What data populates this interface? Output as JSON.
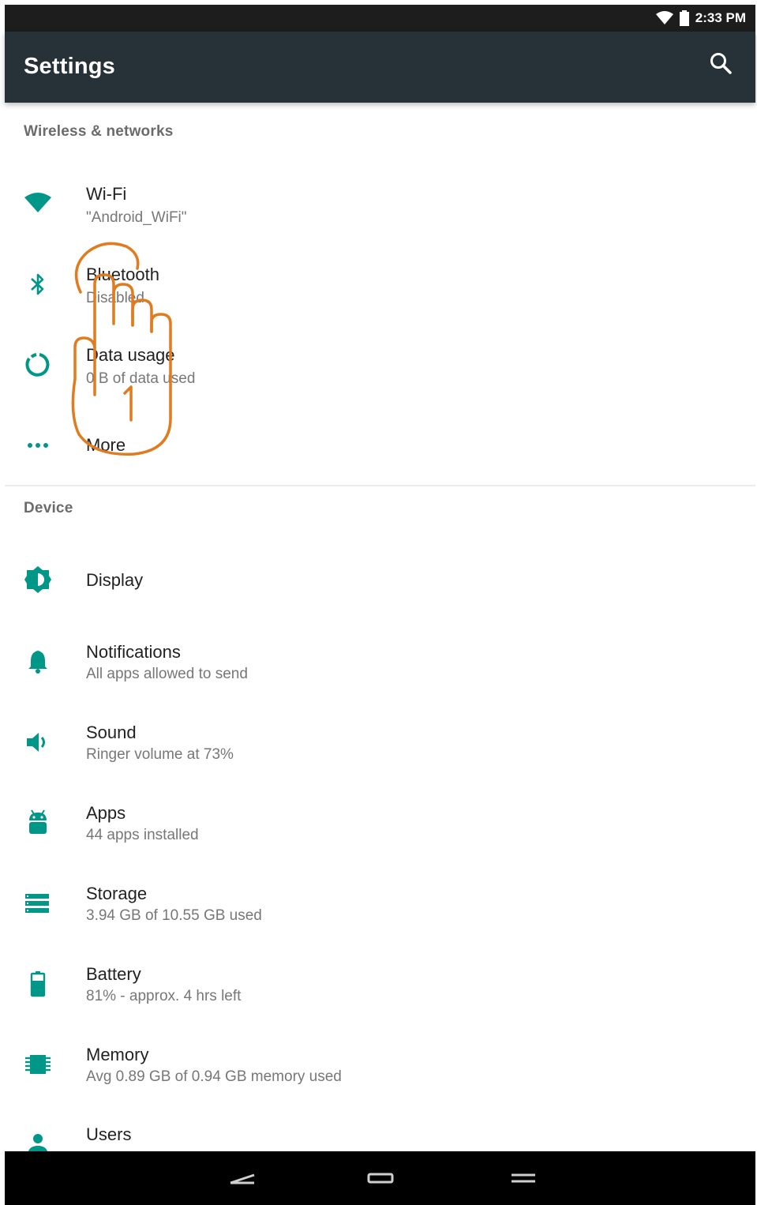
{
  "status_bar": {
    "time": "2:33 PM",
    "icons": [
      "wifi-icon",
      "battery-icon"
    ]
  },
  "app_bar": {
    "title": "Settings",
    "action_icon": "search-icon"
  },
  "colors": {
    "accent": "#009688",
    "app_bar": "#263238",
    "status_bar": "#1d1d1d",
    "gesture": "#e07b1f"
  },
  "sections": [
    {
      "header": "Wireless & networks",
      "items": [
        {
          "icon": "wifi-icon",
          "title": "Wi-Fi",
          "summary": "\"Android_WiFi\""
        },
        {
          "icon": "bluetooth-icon",
          "title": "Bluetooth",
          "summary": "Disabled"
        },
        {
          "icon": "data-usage-icon",
          "title": "Data usage",
          "summary": "0 B of data used"
        },
        {
          "icon": "more-icon",
          "title": "More",
          "summary": ""
        }
      ]
    },
    {
      "header": "Device",
      "items": [
        {
          "icon": "display-icon",
          "title": "Display",
          "summary": ""
        },
        {
          "icon": "notifications-icon",
          "title": "Notifications",
          "summary": "All apps allowed to send"
        },
        {
          "icon": "sound-icon",
          "title": "Sound",
          "summary": "Ringer volume at 73%"
        },
        {
          "icon": "apps-icon",
          "title": "Apps",
          "summary": "44 apps installed"
        },
        {
          "icon": "storage-icon",
          "title": "Storage",
          "summary": "3.94 GB of 10.55 GB used"
        },
        {
          "icon": "battery-icon",
          "title": "Battery",
          "summary": "81% - approx. 4 hrs left"
        },
        {
          "icon": "memory-icon",
          "title": "Memory",
          "summary": "Avg 0.89 GB of 0.94 GB memory used"
        },
        {
          "icon": "users-icon",
          "title": "Users",
          "summary": ""
        }
      ]
    }
  ],
  "gesture_overlay": {
    "icon": "tap-hand-icon",
    "step": "1"
  },
  "nav_bar": {
    "buttons": [
      "back-icon",
      "home-icon",
      "recents-icon"
    ]
  }
}
